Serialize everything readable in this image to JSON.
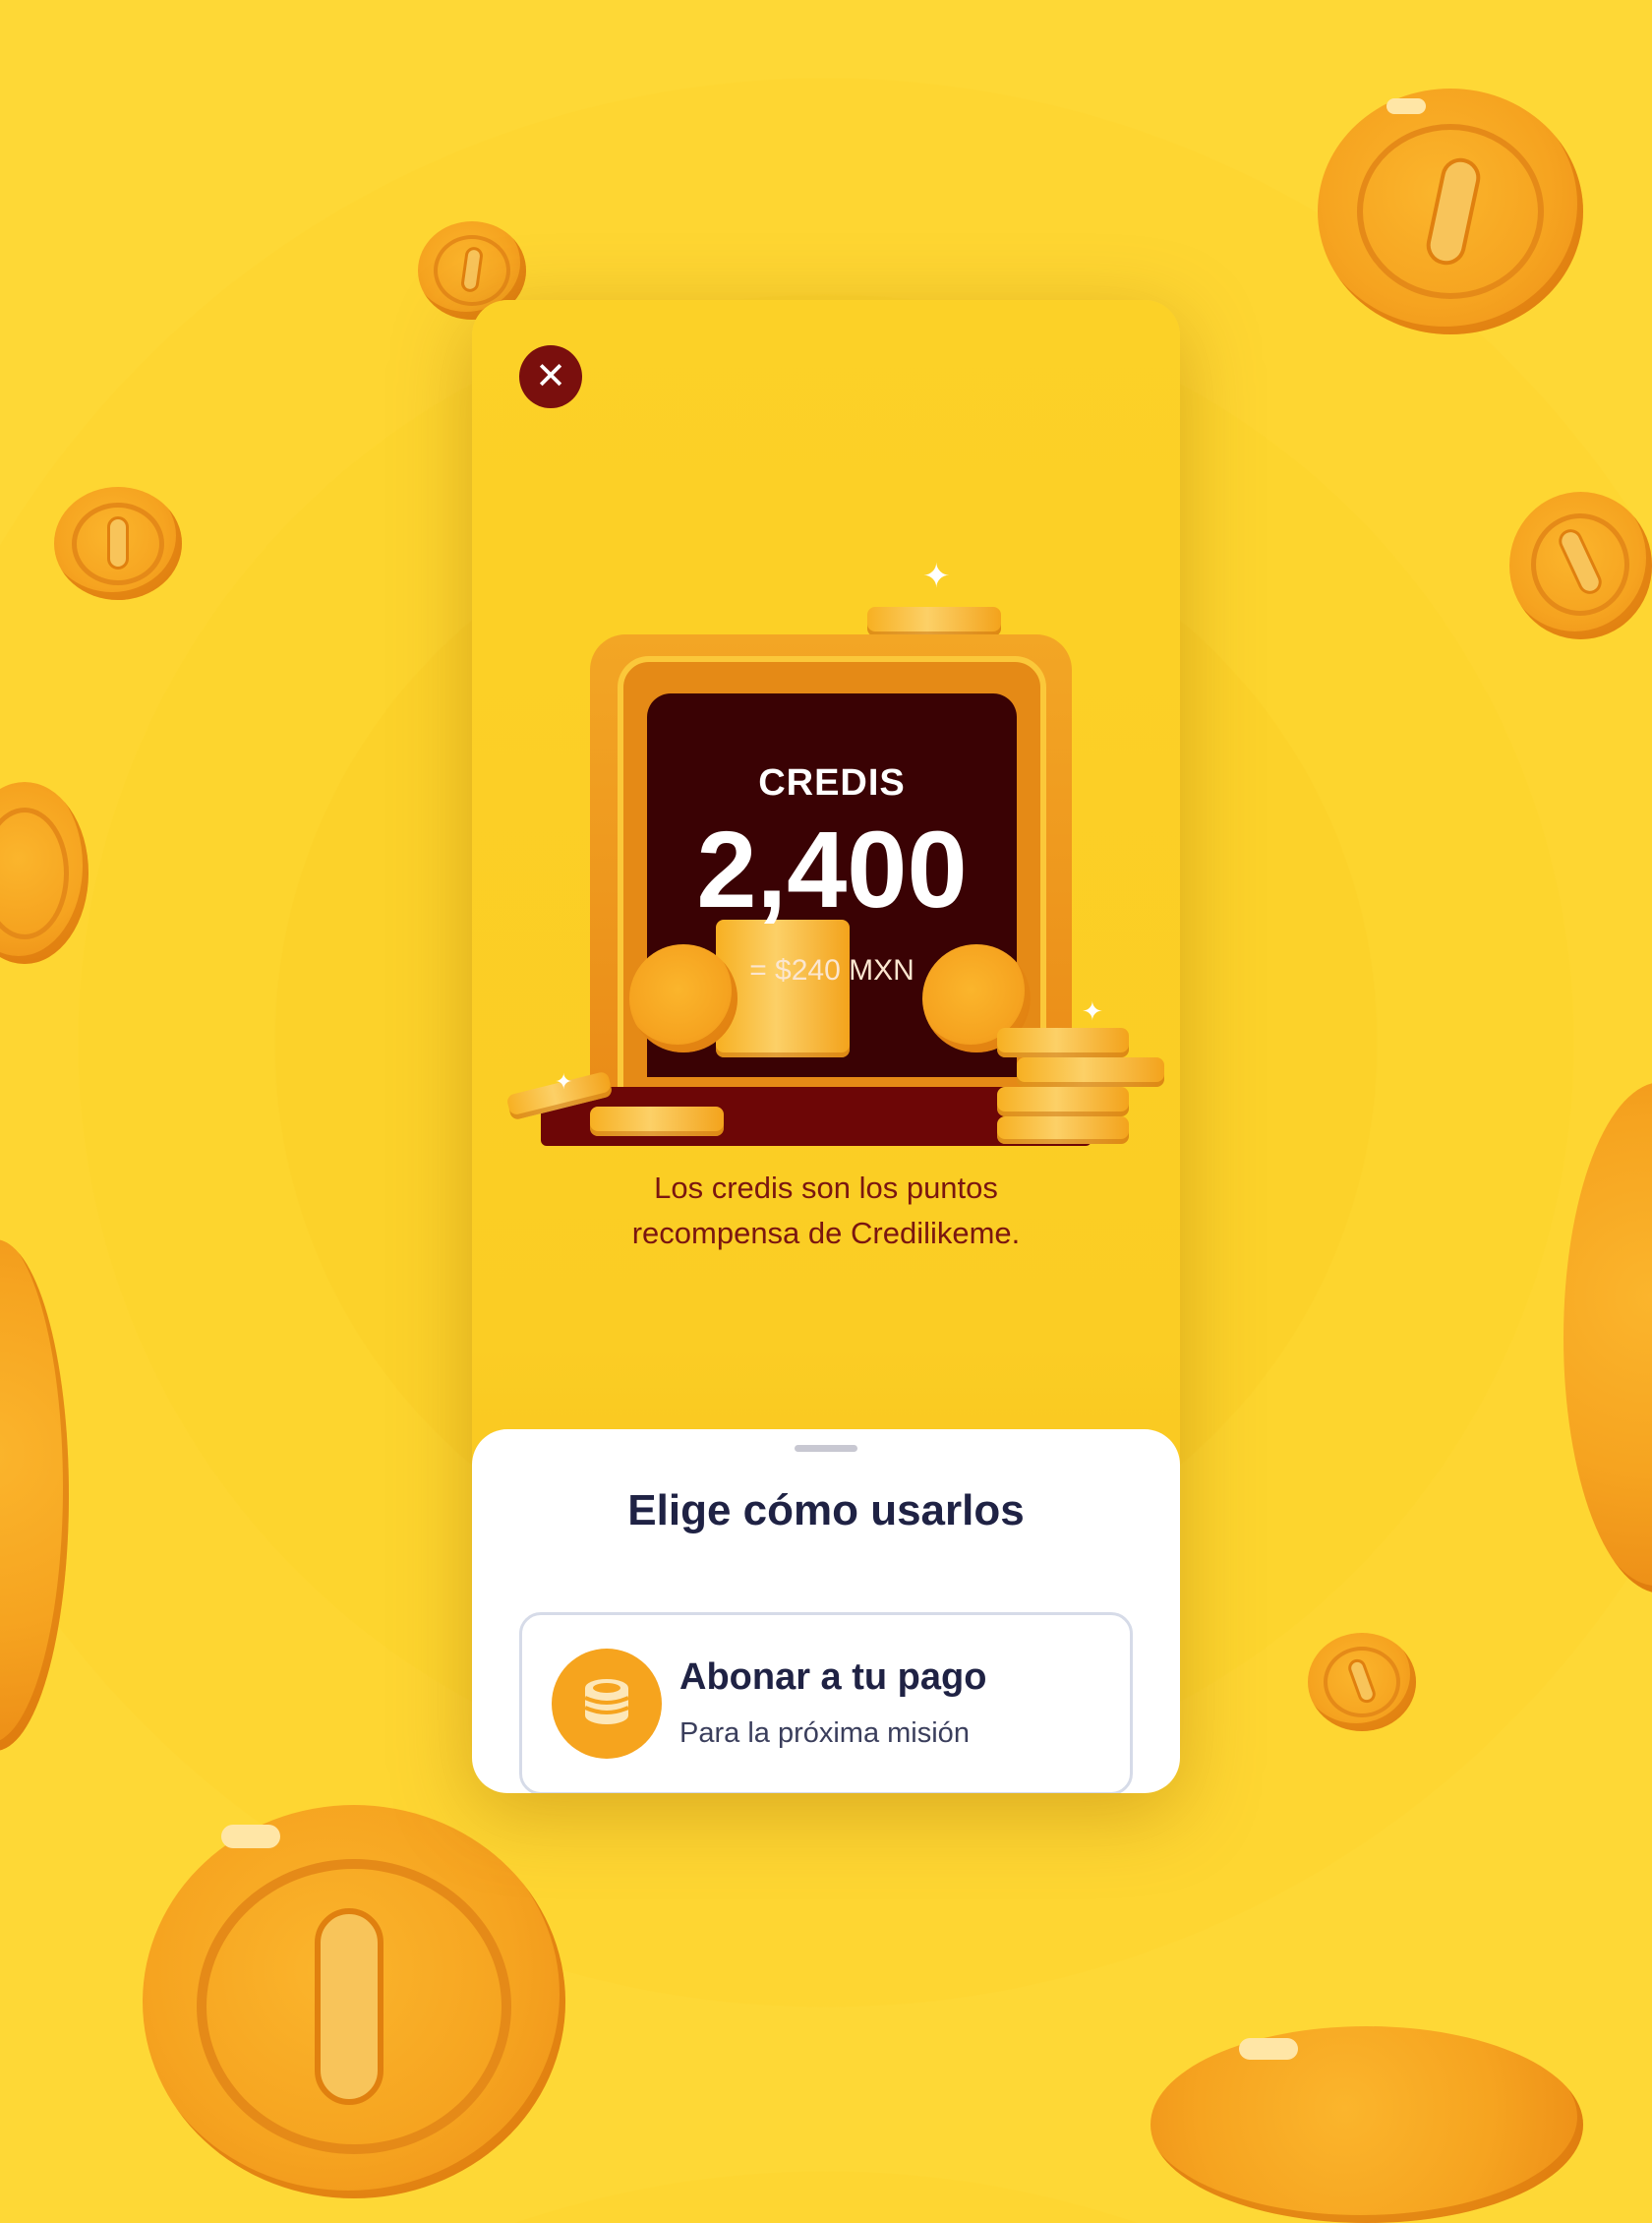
{
  "modal": {
    "close_icon": "close-icon",
    "credis_label": "CREDIS",
    "credis_value": "2,400",
    "credis_equivalent": "= $240 MXN",
    "description_line1": "Los credis son los puntos",
    "description_line2": "recompensa de Credilikeme."
  },
  "sheet": {
    "title": "Elige cómo usarlos",
    "options": [
      {
        "icon": "coin-stack-icon",
        "title": "Abonar a tu pago",
        "subtitle": "Para la próxima misión"
      }
    ]
  },
  "colors": {
    "background": "#fdd52e",
    "close_button": "#7a0f0d",
    "chest_screen": "#3a0204",
    "coin": "#f6a420",
    "text_dark": "#1f2244",
    "description_text": "#7a1610"
  }
}
